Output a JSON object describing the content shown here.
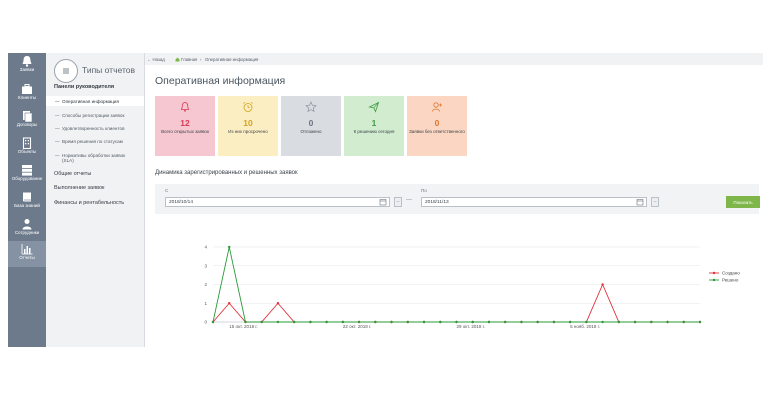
{
  "rail": {
    "items": [
      {
        "label": "Заявки",
        "icon": "bell-icon"
      },
      {
        "label": "Клиенты",
        "icon": "briefcase-icon"
      },
      {
        "label": "Договоры",
        "icon": "documents-icon"
      },
      {
        "label": "Объекты",
        "icon": "building-icon"
      },
      {
        "label": "Оборудование",
        "icon": "server-icon"
      },
      {
        "label": "База знаний",
        "icon": "book-icon"
      },
      {
        "label": "Сотрудники",
        "icon": "user-icon"
      },
      {
        "label": "Отчеты",
        "icon": "bar-chart-icon"
      }
    ],
    "active_index": 7
  },
  "panel": {
    "title": "Типы отчетов",
    "section_main": "Панели руководителя",
    "subitems": [
      "Оперативная информация",
      "Способы регистрации заявок",
      "Удовлетворенность клиентов",
      "Время решения по статусам",
      "Нормативы обработки заявок (SLA)"
    ],
    "active_subitem": 0,
    "sections": [
      "Общие отчеты",
      "Выполнение заявок",
      "Финансы и рентабельность"
    ]
  },
  "breadcrumb": {
    "back": "← Назад",
    "home": "Главная",
    "separator": "›",
    "current": "Оперативная информация"
  },
  "page_title": "Оперативная информация",
  "cards": [
    {
      "icon": "bell-outline-icon",
      "value": "12",
      "label": "Всего открытых заявок",
      "bg": "#f6c6d1",
      "color": "#d83a52"
    },
    {
      "icon": "alarm-clock-icon",
      "value": "10",
      "label": "Из них просрочено",
      "bg": "#fbeec2",
      "color": "#d8a020"
    },
    {
      "icon": "star-outline-icon",
      "value": "0",
      "label": "Отложено",
      "bg": "#d9dce1",
      "color": "#6d7680"
    },
    {
      "icon": "paper-plane-icon",
      "value": "1",
      "label": "К решению сегодня",
      "bg": "#d2ecd0",
      "color": "#3f9a3f"
    },
    {
      "icon": "user-plus-icon",
      "value": "0",
      "label": "Заявки без ответственного",
      "bg": "#fbd6c2",
      "color": "#e0762e"
    }
  ],
  "section_title": "Динамика зарегистрированных и решенных заявок",
  "filter": {
    "from_label": "С",
    "from_value": "2018/10/14",
    "to_label": "По",
    "to_value": "2018/11/13",
    "range_sep": "—",
    "show_button": "Показать"
  },
  "chart_data": {
    "type": "line",
    "x_tick_labels": [
      "15 окт. 2018 г.",
      "22 окт. 2018 г.",
      "29 окт. 2018 г.",
      "5 нояб. 2018 г."
    ],
    "x_tick_indices": [
      1,
      8,
      15,
      22
    ],
    "ylim": [
      0,
      4
    ],
    "y_ticks": [
      "0",
      "1",
      "2",
      "3",
      "4"
    ],
    "grid": true,
    "legend_placement": "right",
    "series": [
      {
        "name": "Создано",
        "color": "#e0303c",
        "values": [
          0,
          1,
          0,
          0,
          1,
          0,
          0,
          0,
          0,
          0,
          0,
          0,
          0,
          0,
          0,
          0,
          0,
          0,
          0,
          0,
          0,
          0,
          0,
          0,
          2,
          0,
          0,
          0,
          0,
          0,
          0
        ]
      },
      {
        "name": "Решено",
        "color": "#2a9a38",
        "values": [
          0,
          4,
          0,
          0,
          0,
          0,
          0,
          0,
          0,
          0,
          0,
          0,
          0,
          0,
          0,
          0,
          0,
          0,
          0,
          0,
          0,
          0,
          0,
          0,
          0,
          0,
          0,
          0,
          0,
          0,
          0
        ]
      }
    ]
  }
}
